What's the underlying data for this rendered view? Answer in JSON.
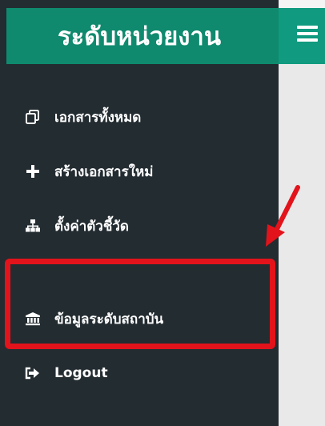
{
  "app": {
    "title": "ระดับหน่วยงาน"
  },
  "sidebar": {
    "items": [
      {
        "label": "เอกสารทั้งหมด",
        "icon": "copy-icon"
      },
      {
        "label": "สร้างเอกสารใหม่",
        "icon": "plus-icon"
      },
      {
        "label": "ตั้งค่าตัวชี้วัด",
        "icon": "sitemap-icon"
      },
      {
        "label": "ข้อมูลระดับสถาบัน",
        "icon": "institution-icon"
      },
      {
        "label": "Logout",
        "icon": "sign-out-icon"
      }
    ]
  },
  "annotation": {
    "color": "#e3131b"
  },
  "colors": {
    "sidebar_bg": "#232c31",
    "brand_bg": "#0f8a6e",
    "topbar_bg": "#109a80"
  }
}
